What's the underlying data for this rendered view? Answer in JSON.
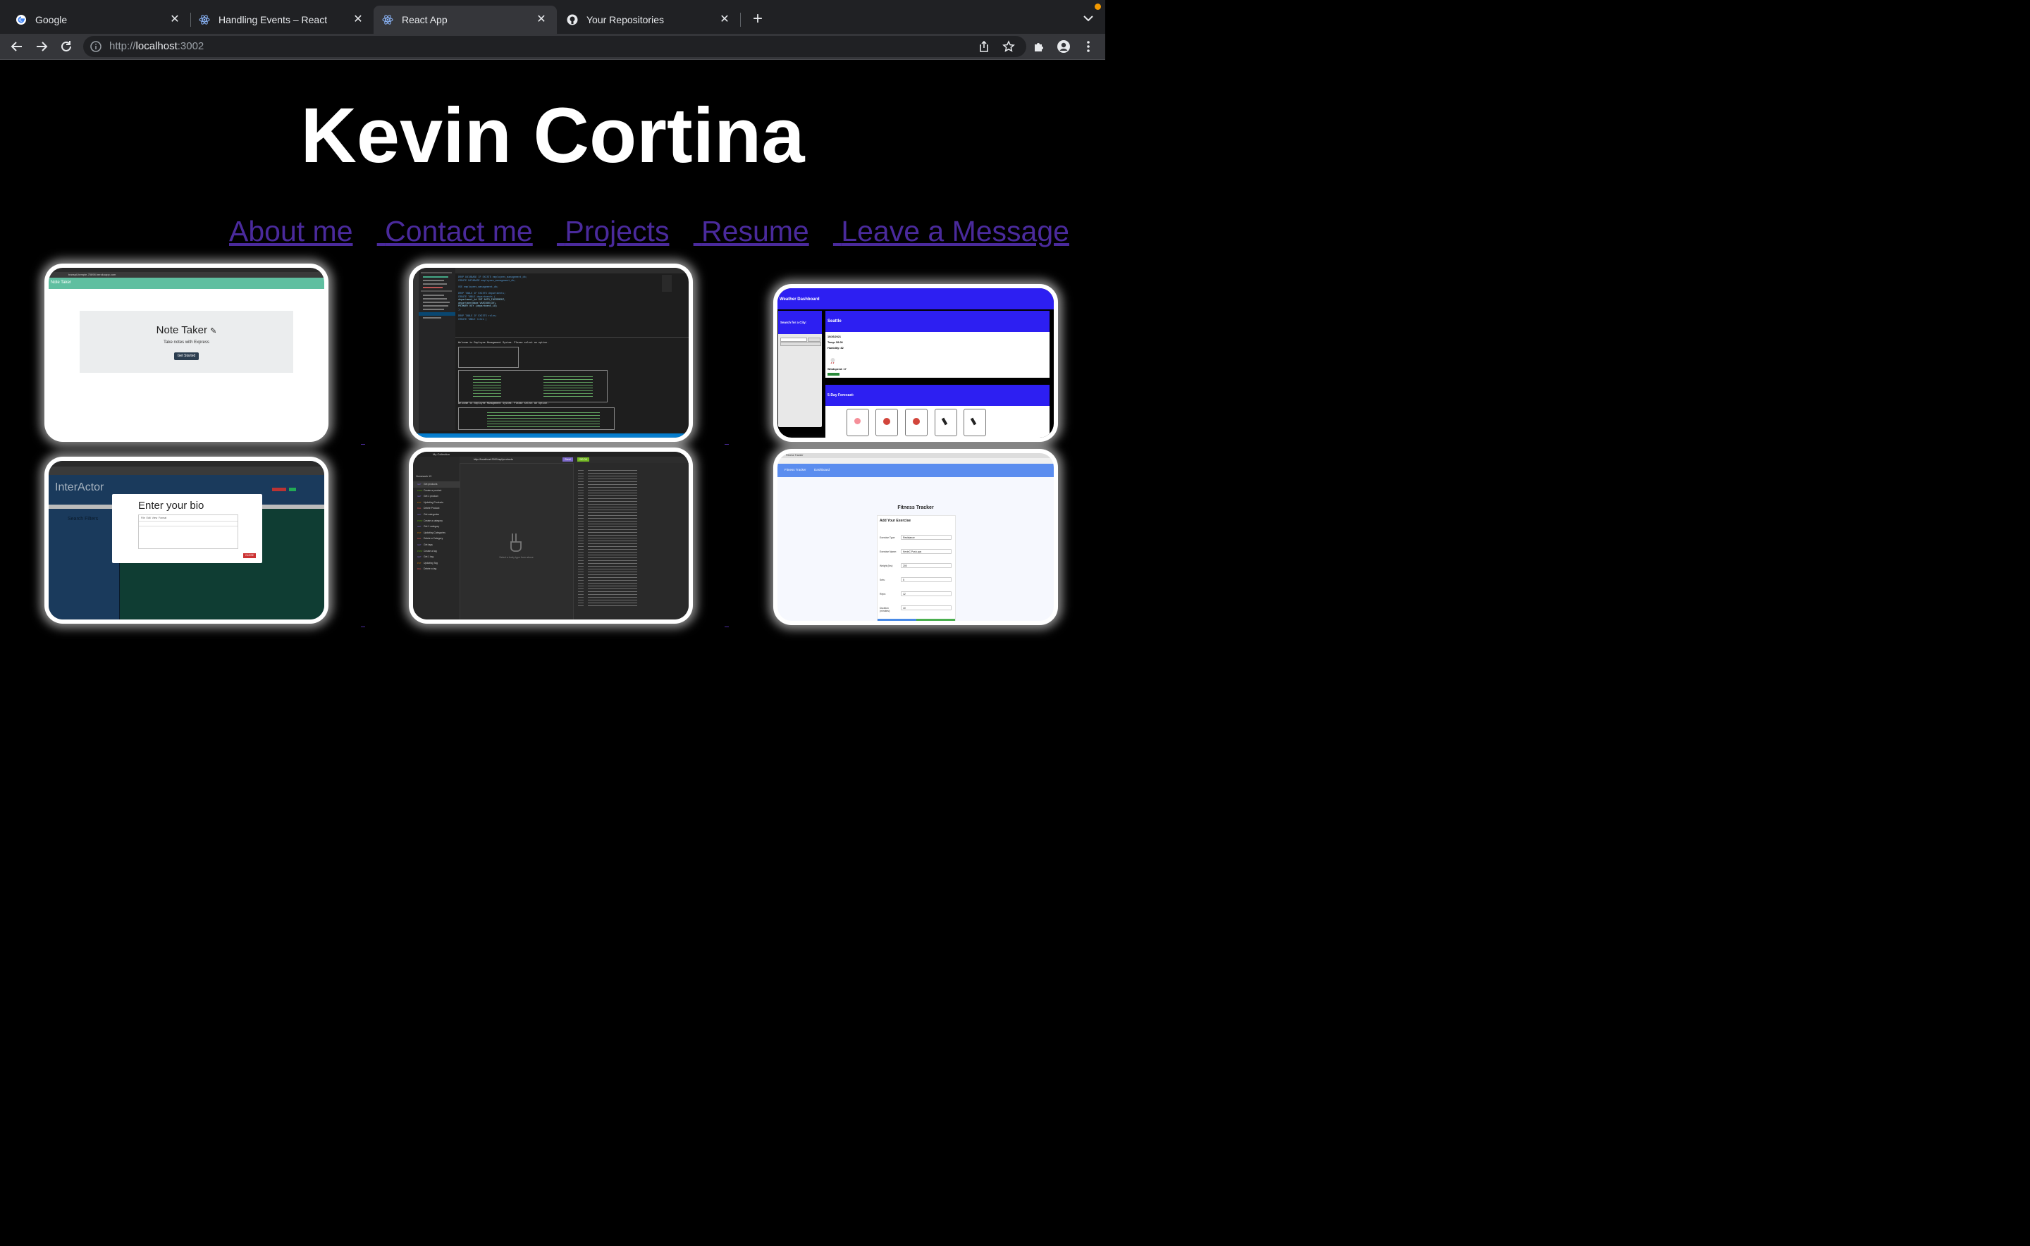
{
  "browser": {
    "tabs": [
      {
        "title": "Google",
        "icon": "google-icon",
        "active": false
      },
      {
        "title": "Handling Events – React",
        "icon": "react-icon",
        "active": false
      },
      {
        "title": "React App",
        "icon": "react-icon",
        "active": true
      },
      {
        "title": "Your Repositories",
        "icon": "github-icon",
        "active": false
      }
    ],
    "url_scheme": "http://",
    "url_host": "localhost",
    "url_port": ":3002"
  },
  "page": {
    "title": "Kevin Cortina",
    "nav": [
      "About me",
      "Contact me",
      "Projects",
      "Resume",
      "Leave a Message"
    ]
  },
  "projects": {
    "note_taker": {
      "url": "transpil-temple-75898.herokuapp.com",
      "header": "Note Taker",
      "title": "Note Taker",
      "subtitle": "Take notes with Express",
      "button": "Get Started"
    },
    "employee_db": {
      "sql_lines": [
        "DROP DATABASE IF EXISTS employees_management_db;",
        "CREATE DATABASE employees_management_db;",
        "USE employees_management_db;",
        "DROP TABLE IF EXISTS departments;",
        "CREATE TABLE departments (",
        "  department_id INT AUTO_INCREMENT,",
        "  departmentName VARCHAR(30),",
        "  PRIMARY KEY (department_id)",
        ");",
        "DROP TABLE IF EXISTS roles;",
        "CREATE TABLE roles ("
      ],
      "prompt": "Welcome to Employee Management System. Please select an option."
    },
    "weather": {
      "header": "Weather Dashboard",
      "search_label": "Search for a City:",
      "city": "Seattle",
      "date": "10/26/2021",
      "temp": "Temp: 59.09",
      "humidity": "Humidity: 82",
      "wind": "Windspeed: 17",
      "forecast_title": "5-Day Forecast:"
    },
    "interactor": {
      "brand": "InterActor",
      "modal_title": "Enter your bio",
      "menu": [
        "File",
        "Edit",
        "View",
        "Format"
      ],
      "search_label": "Search Filters",
      "close": "CLOSE"
    },
    "api_client": {
      "collection": "My Collection",
      "url": "http://localhost:3001/api/products",
      "send": "Send",
      "status": "200 OK",
      "folder": "Homework 13",
      "requests": [
        "Get products",
        "Create a product",
        "Get 1 product",
        "Updating Products",
        "Delete Product",
        "Get categories",
        "Create a category",
        "Get 1 category",
        "Updating Categories",
        "Delete a Category",
        "Get tags",
        "Create a tag",
        "Get 1 tag",
        "Updating Tag",
        "Delete a tag"
      ],
      "empty_body": "Select a body type from above"
    },
    "fitness": {
      "tab": "Fitness Tracker",
      "nav": [
        "Fitness Tracker",
        "Dashboard"
      ],
      "title": "Fitness Tracker",
      "form_title": "Add Your Exercise",
      "fields": [
        {
          "label": "Exercise Type:",
          "value": "Resistance"
        },
        {
          "label": "Exercise Name:",
          "value": "KevinC Push-ups"
        },
        {
          "label": "Weight (lbs):",
          "value": "200"
        },
        {
          "label": "Sets:",
          "value": "5"
        },
        {
          "label": "Reps:",
          "value": "12"
        },
        {
          "label": "Duration (minutes):",
          "value": "10"
        }
      ]
    }
  },
  "colors": {
    "link": "#4a2a9c",
    "note_taker_header": "#5fbfa0",
    "weather_blue": "#2d1ff2",
    "fitness_nav": "#5b8def",
    "interactor_bg": "#1a3a5c",
    "interactor_green": "#0f3d33"
  }
}
